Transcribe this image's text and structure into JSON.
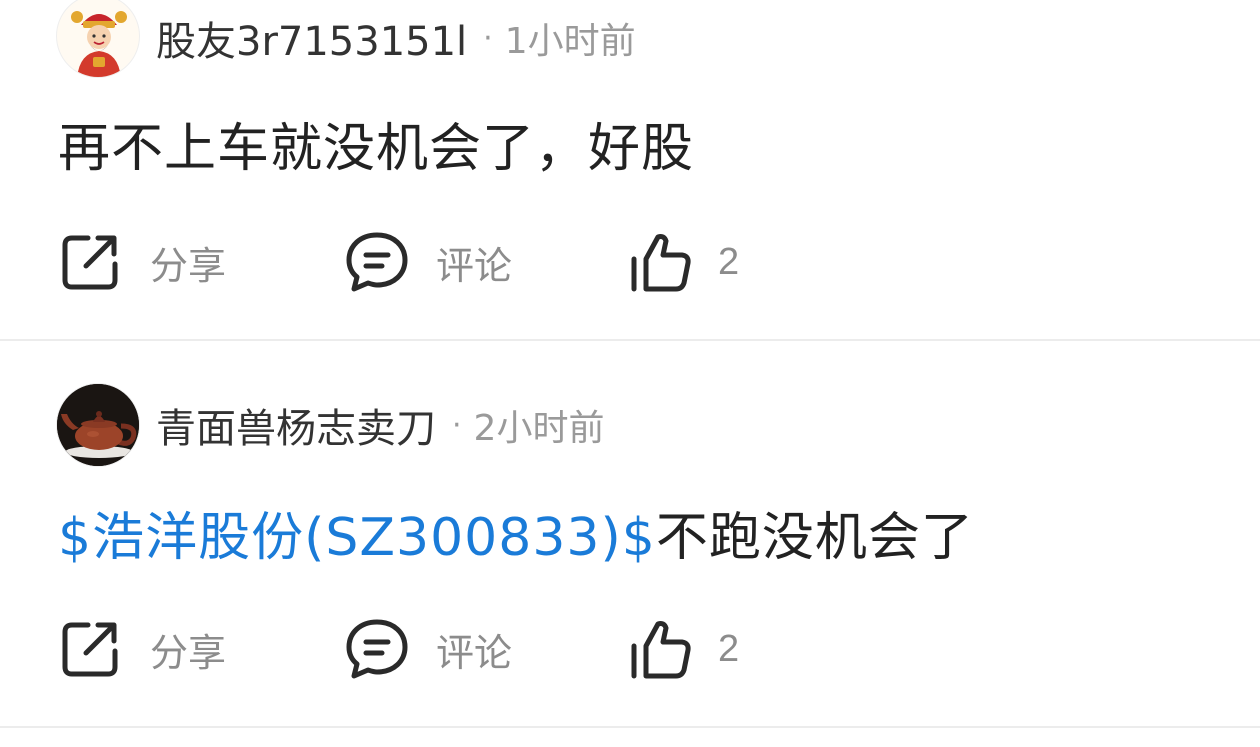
{
  "posts": [
    {
      "username": "股友3r7153151l",
      "separator": "·",
      "time": "1小时前",
      "content_prefix": "",
      "content_text": "再不上车就没机会了，好股",
      "actions": {
        "share_label": "分享",
        "comment_label": "评论",
        "like_count": "2"
      },
      "avatar": "god-of-wealth-avatar"
    },
    {
      "username": "青面兽杨志卖刀",
      "separator": "·",
      "time": "2小时前",
      "content_prefix": "$浩洋股份(SZ300833)$",
      "content_text": "不跑没机会了",
      "actions": {
        "share_label": "分享",
        "comment_label": "评论",
        "like_count": "2"
      },
      "avatar": "teapot-avatar"
    }
  ],
  "colors": {
    "link": "#1a7bd8",
    "muted": "#9a9a9a",
    "text": "#222222",
    "divider": "#ececec"
  },
  "icons": {
    "share": "share-icon",
    "comment": "comment-icon",
    "like": "thumbs-up-icon"
  }
}
